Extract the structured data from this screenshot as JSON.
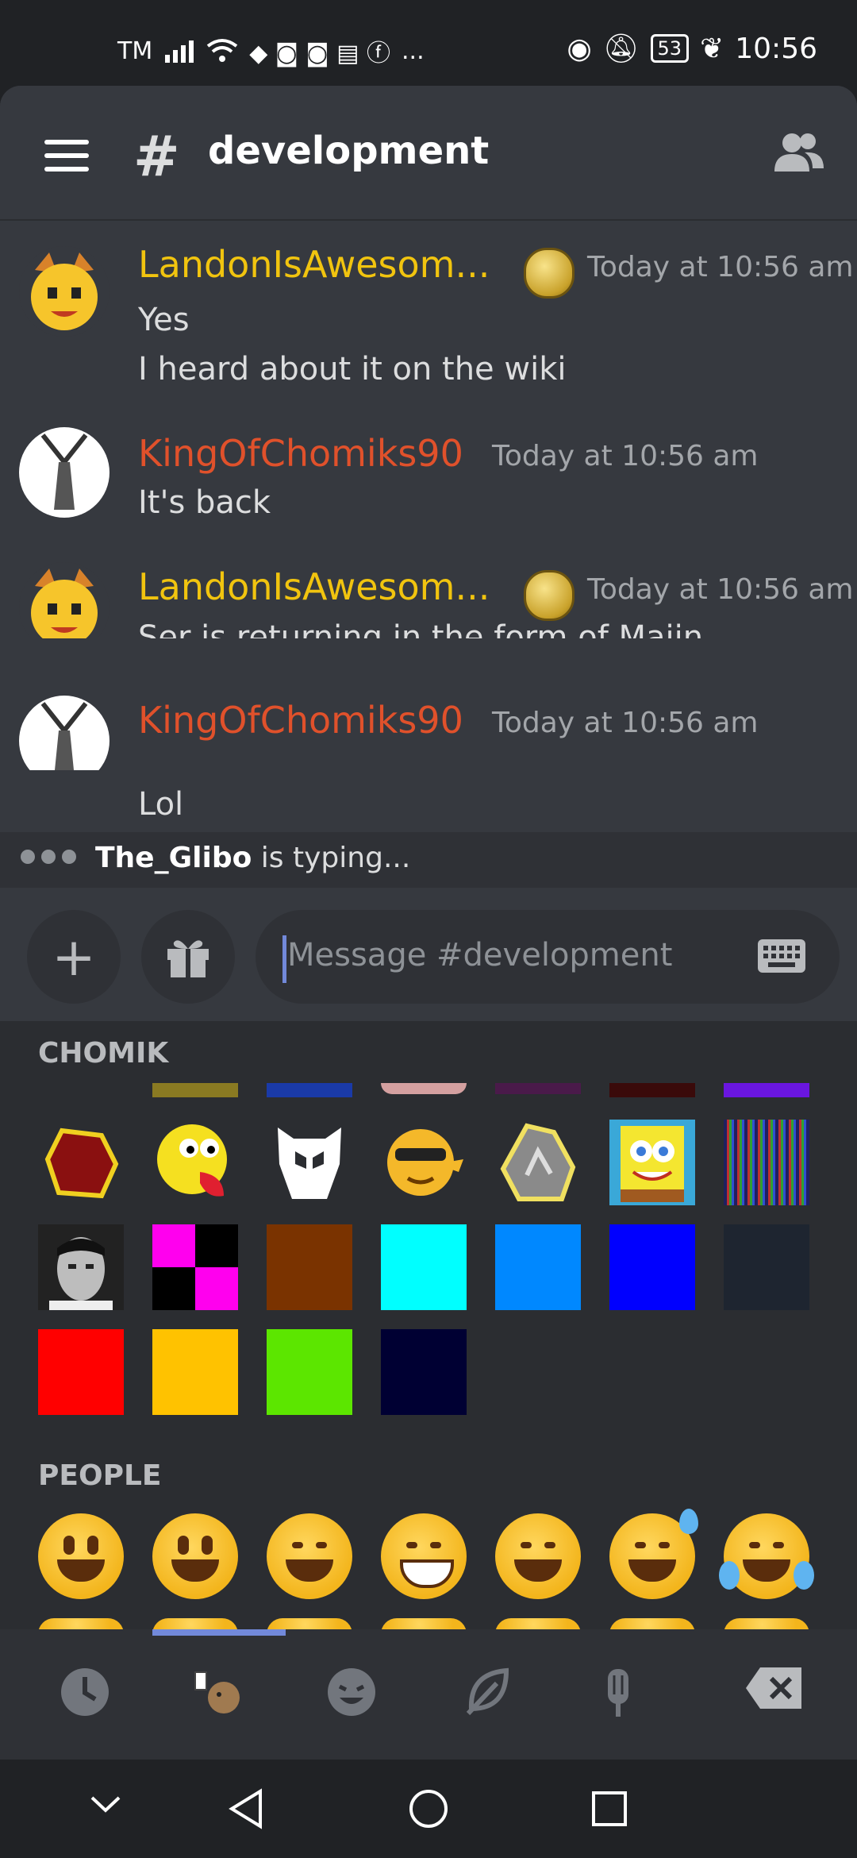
{
  "status_bar": {
    "carrier": "TM",
    "battery": "53",
    "time": "10:56",
    "overflow": "..."
  },
  "header": {
    "channel_title": "development",
    "menu_icon": "hamburger-icon",
    "channel_icon": "locked-hash-icon",
    "members_icon": "members-icon"
  },
  "messages": [
    {
      "author": "LandonIsAwesom...",
      "time": "Today at 10:56 am",
      "lines": [
        "Yes",
        "I heard about it on the wiki"
      ]
    },
    {
      "author": "KingOfChomiks90",
      "time": "Today at 10:56 am",
      "lines": [
        "It's back"
      ]
    },
    {
      "author": "LandonIsAwesom...",
      "time": "Today at 10:56 am",
      "lines": [
        "Ser is returning in the form of Majin"
      ]
    },
    {
      "author": "KingOfChomiks90",
      "time": "Today at 10:56 am",
      "lines": [
        "Lol"
      ]
    }
  ],
  "typing": {
    "user": "The_Glibo",
    "text": "is typing..."
  },
  "composer": {
    "placeholder": "Message #development"
  },
  "emoji_panel": {
    "sections": [
      "CHOMIK",
      "PEOPLE"
    ],
    "custom_colors": [
      "#ff00ee",
      "#7a3300",
      "#00ffff",
      "#0088ff",
      "#0000ff",
      "#1e2530",
      "#ff0000",
      "#ffc200",
      "#5ce600",
      "#000033"
    ]
  },
  "tabs": [
    "recent-icon",
    "chomik-guild-icon",
    "people-icon",
    "nature-icon",
    "food-icon",
    "backspace-icon"
  ]
}
